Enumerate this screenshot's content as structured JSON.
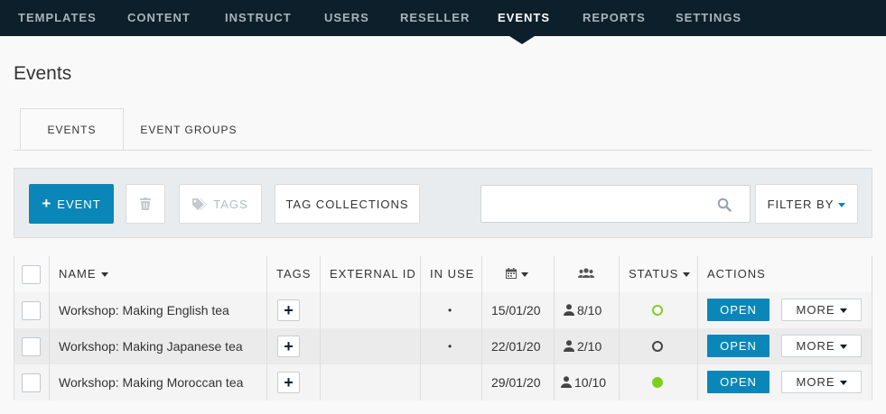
{
  "nav": {
    "items": [
      "TEMPLATES",
      "CONTENT",
      "INSTRUCT",
      "USERS",
      "RESELLER",
      "EVENTS",
      "REPORTS",
      "SETTINGS"
    ],
    "active": "EVENTS"
  },
  "page_title": "Events",
  "tabs": [
    {
      "label": "EVENTS",
      "active": true
    },
    {
      "label": "EVENT GROUPS",
      "active": false
    }
  ],
  "toolbar": {
    "add_event_label": "EVENT",
    "tags_label": "TAGS",
    "tag_collections_label": "TAG COLLECTIONS",
    "search_value": "",
    "filter_label": "FILTER BY"
  },
  "table": {
    "headers": {
      "name": "NAME",
      "tags": "TAGS",
      "external_id": "EXTERNAL ID",
      "in_use": "IN USE",
      "status": "STATUS",
      "actions": "ACTIONS"
    },
    "rows": [
      {
        "name": "Workshop: Making English tea",
        "in_use": "•",
        "date": "15/01/20",
        "attendees": "8/10",
        "status": "open-circle-green",
        "open_label": "OPEN",
        "more_label": "MORE"
      },
      {
        "name": "Workshop: Making Japanese tea",
        "in_use": "•",
        "date": "22/01/20",
        "attendees": "2/10",
        "status": "open-circle-dark",
        "open_label": "OPEN",
        "more_label": "MORE"
      },
      {
        "name": "Workshop: Making Moroccan tea",
        "in_use": "",
        "date": "29/01/20",
        "attendees": "10/10",
        "status": "filled-circle-green",
        "open_label": "OPEN",
        "more_label": "MORE"
      }
    ]
  },
  "colors": {
    "nav_bg": "#0d1f2b",
    "primary": "#0a87b8",
    "status_green": "#7dcf1f",
    "status_dark": "#444444"
  }
}
